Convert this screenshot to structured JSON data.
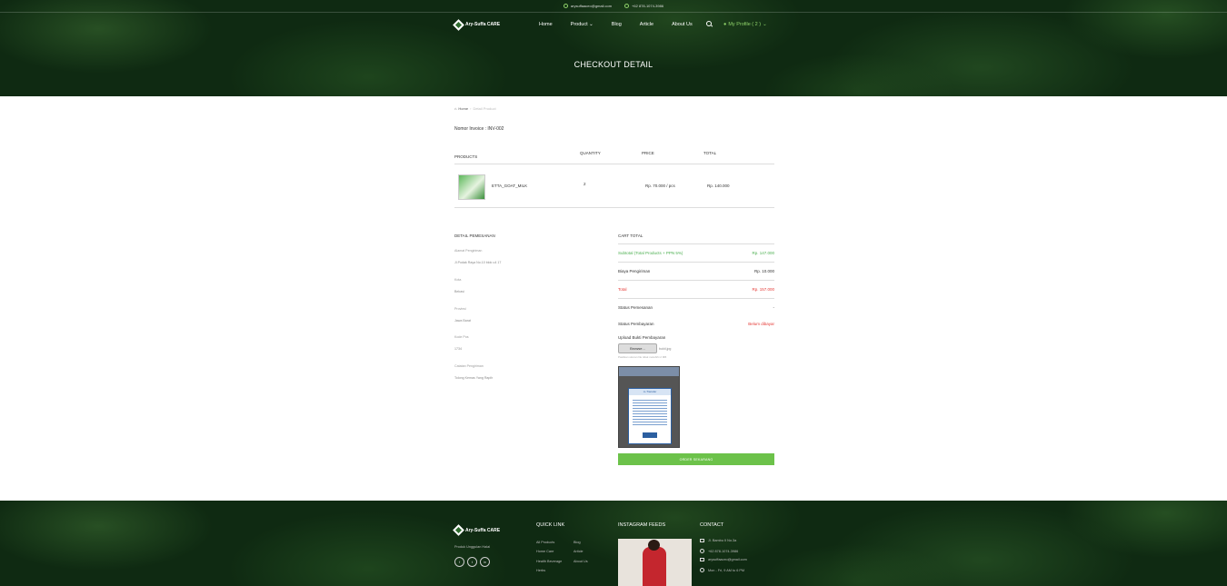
{
  "topbar": {
    "email": "arysuffaaceo@gmail.com",
    "phone": "+62 878-1074-3986"
  },
  "brand": {
    "name": "Ary-Suffa CARE"
  },
  "nav": {
    "items": [
      "Home",
      "Product",
      "Blog",
      "Article",
      "About Us"
    ],
    "profile": "My Profile ( 2 )"
  },
  "hero": {
    "title": "CHECKOUT DETAIL"
  },
  "breadcrumb": {
    "home": "Home",
    "current": "Detail Product"
  },
  "invoice": "Nomor Invoice : INV-002",
  "table": {
    "headers": [
      "PRODUCTS",
      "QUANTITY",
      "PRICE",
      "TOTAL"
    ],
    "rows": [
      {
        "product": "ETTA_GOAT_MILK",
        "quantity": "2",
        "price": "Rp. 70.000 / pcs",
        "total": "Rp. 140.000"
      }
    ]
  },
  "detail": {
    "title": "DETAIL PEMESANAN",
    "fields": [
      {
        "label": "Alamat Pengiriman",
        "value": "Jl.Podak Raya No.10 blok u4 17"
      },
      {
        "label": "Kota",
        "value": "Bekasi"
      },
      {
        "label": "Provinsi",
        "value": "Jawa Barat"
      },
      {
        "label": "Kode Pos",
        "value": "1734"
      },
      {
        "label": "Catatan Pengiriman",
        "value": "Tolong Kemas Yang Rapih"
      }
    ]
  },
  "cart": {
    "title": "CART TOTAL",
    "subtotal_label": "Subtotal (Total Products + PPN 5%)",
    "subtotal_value": "Rp. 147.000",
    "shipping_label": "Biaya Pengiriman",
    "shipping_value": "Rp. 10.000",
    "total_label": "Total",
    "total_value": "Rp. 157.000",
    "order_status_label": "Status Pemesanan",
    "order_status_value": "-",
    "payment_status_label": "Status Pembayaran",
    "payment_status_value": "Belum dibayar",
    "upload_label": "Upload Bukti Pembayaran",
    "browse_label": "Browse...",
    "file_name": "bukti.jpg",
    "hint": "Pastikan ukuran file tidak melebihi 2 MB",
    "preview_title": "m-Transfer",
    "order_button": "ORDER SEKARANG",
    "colors": {
      "subtotal": "#4caf50",
      "total": "#e53935",
      "unpaid": "#e53935",
      "button": "#6cc24a"
    }
  },
  "footer": {
    "tagline": "Produk Unggulan Halal",
    "social": [
      "f",
      "t",
      "in"
    ],
    "quick_link_title": "QUICK LINK",
    "quick_links": [
      "All Products",
      "Blog",
      "Home Care",
      "Article",
      "Health Beverage",
      "About Us",
      "Herbs"
    ],
    "instagram_title": "INSTAGRAM FEEDS",
    "contact_title": "CONTACT",
    "contact": {
      "address": "Jl. Bambu II No.3a",
      "phone": "+62 878-1074-3986",
      "email": "arysuffaaceo@gmail.com",
      "hours": "Mon - Fri, 9 AM to 6 PM"
    }
  }
}
